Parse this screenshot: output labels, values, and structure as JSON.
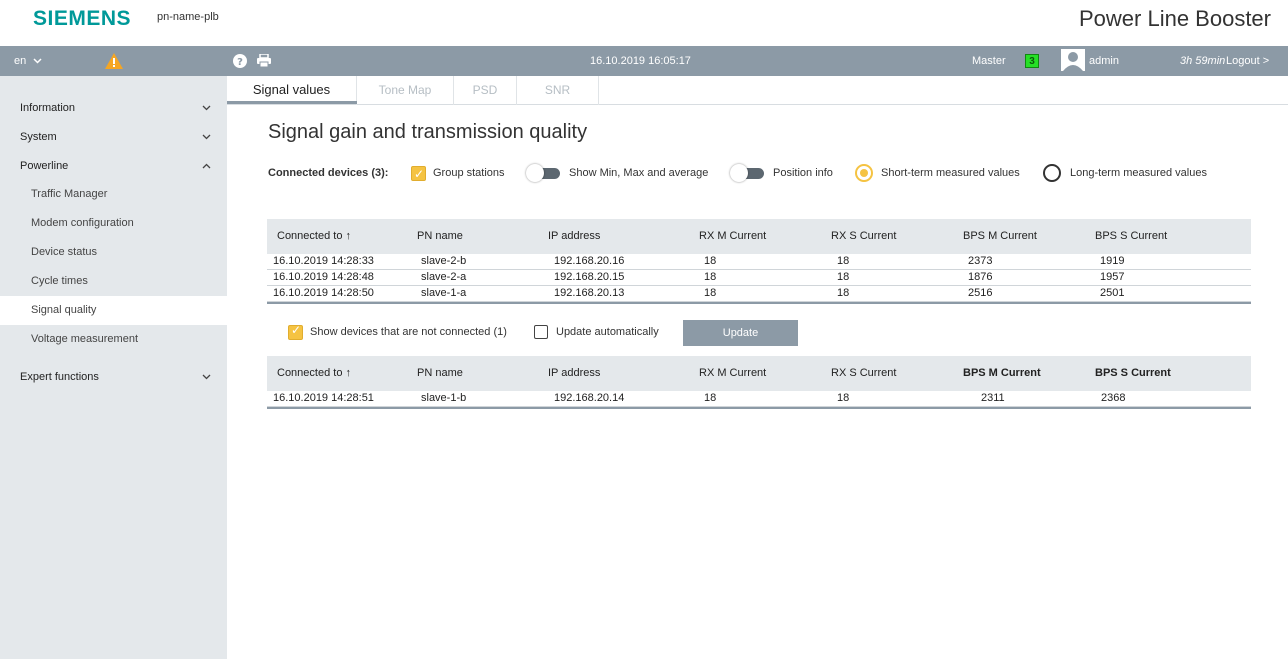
{
  "header": {
    "logo": "SIEMENS",
    "device_name": "pn-name-plb",
    "product_name": "Power Line Booster"
  },
  "toolbar": {
    "language": "en",
    "language_icon": "chevron-down-icon",
    "warning_icon": "warning-icon",
    "help_icon": "help-icon",
    "print_icon": "print-icon",
    "datetime": "16.10.2019 16:05:17",
    "role": "Master",
    "role_badge": "3",
    "user": "admin",
    "session_time": "3h 59min",
    "logout": "Logout >"
  },
  "sidebar": {
    "items": [
      {
        "label": "Information",
        "chevron": "⌄"
      },
      {
        "label": "System",
        "chevron": "⌄"
      },
      {
        "label": "Powerline",
        "chevron": "^"
      },
      {
        "label": "Traffic Manager"
      },
      {
        "label": "Modem configuration"
      },
      {
        "label": "Device status"
      },
      {
        "label": "Cycle times"
      },
      {
        "label": "Signal quality"
      },
      {
        "label": "Voltage measurement"
      },
      {
        "label": "Expert functions",
        "chevron": "⌄"
      }
    ]
  },
  "tabs": [
    {
      "label": "Signal values"
    },
    {
      "label": "Tone Map"
    },
    {
      "label": "PSD"
    },
    {
      "label": "SNR"
    }
  ],
  "main": {
    "title": "Signal gain and transmission quality",
    "connected_devices": "Connected devices (3):",
    "group_stations": "Group stations",
    "show_min_max": "Show Min, Max and average",
    "position_info": "Position info",
    "short_term": "Short-term measured values",
    "long_term": "Long-term measured values",
    "show_not_connected": "Show devices that are not connected (1)",
    "update_automatically": "Update automatically",
    "update_button": "Update"
  },
  "columns": [
    "Connected to ↑",
    "PN name",
    "IP address",
    "RX M Current",
    "RX S Current",
    "BPS M Current",
    "BPS S Current"
  ],
  "connected_table": {
    "rows": [
      [
        "16.10.2019 14:28:33",
        "slave-2-b",
        "192.168.20.16",
        "18",
        "18",
        "2373",
        "1919"
      ],
      [
        "16.10.2019 14:28:48",
        "slave-2-a",
        "192.168.20.15",
        "18",
        "18",
        "1876",
        "1957"
      ],
      [
        "16.10.2019 14:28:50",
        "slave-1-a",
        "192.168.20.13",
        "18",
        "18",
        "2516",
        "2501"
      ]
    ]
  },
  "disconnected_table": {
    "rows": [
      [
        "16.10.2019 14:28:51",
        "slave-1-b",
        "192.168.20.14",
        "18",
        "18",
        "2311",
        "2368"
      ]
    ]
  },
  "colors": {
    "brand": "#009999",
    "toolbar": "#8c9aa6",
    "accent": "#f5c342",
    "badge": "#26e026",
    "sidebar": "#e4e8eb"
  }
}
